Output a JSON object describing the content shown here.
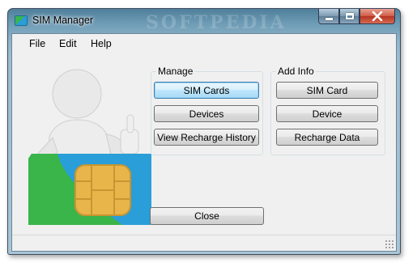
{
  "window": {
    "title": "SIM Manager",
    "watermark": "SOFTPEDIA"
  },
  "menu": {
    "file": "File",
    "edit": "Edit",
    "help": "Help"
  },
  "manage": {
    "label": "Manage",
    "buttons": [
      "SIM Cards",
      "Devices",
      "View Recharge History"
    ]
  },
  "add_info": {
    "label": "Add Info",
    "buttons": [
      "SIM Card",
      "Device",
      "Recharge Data"
    ]
  },
  "close_label": "Close",
  "colors": {
    "sim_green": "#3ab54a",
    "sim_blue": "#2a9ed8",
    "chip_gold": "#e7b54a"
  }
}
